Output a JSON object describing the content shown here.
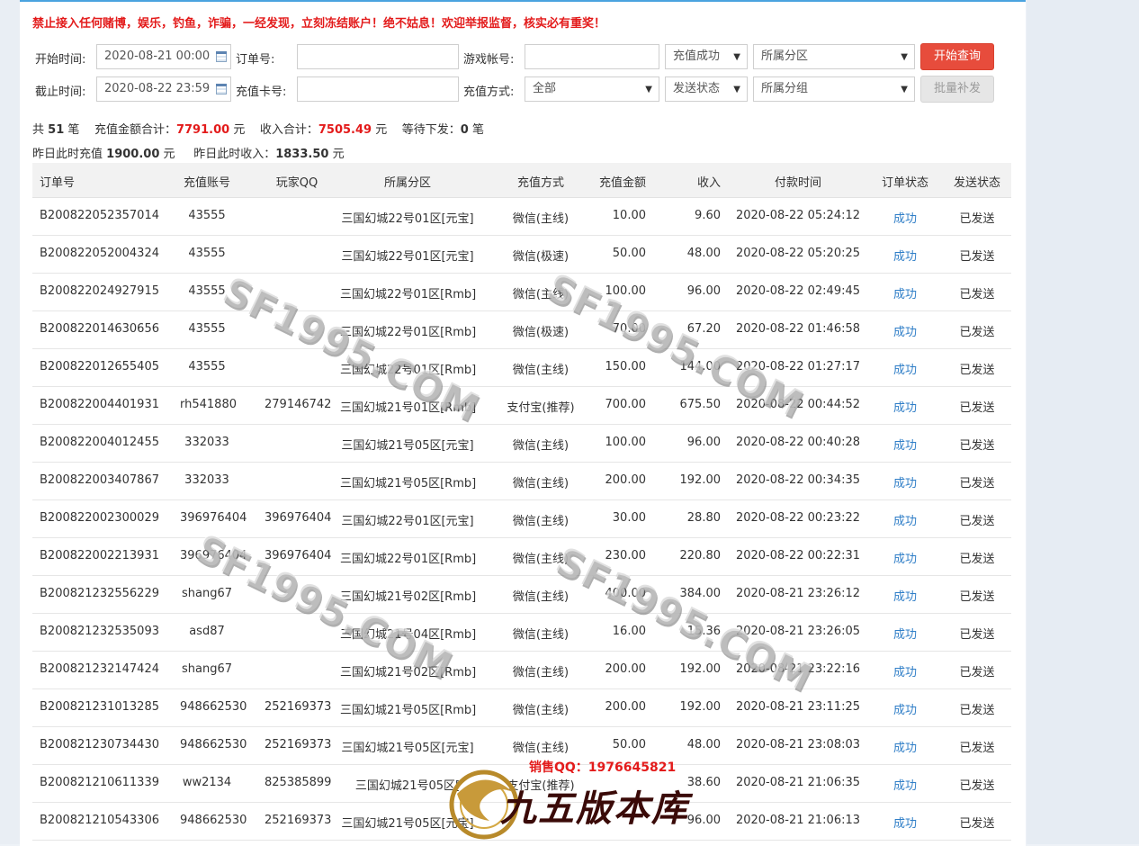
{
  "warning": "禁止接入任何赌博，娱乐，钓鱼，诈骗，一经发现，立刻冻结账户！绝不姑息！欢迎举报监督，核实必有重奖！",
  "filters": {
    "start_time_label": "开始时间:",
    "start_time_value": "2020-08-21 00:00",
    "end_time_label": "截止时间:",
    "end_time_value": "2020-08-22 23:59",
    "order_no_label": "订单号:",
    "order_no_value": "",
    "card_no_label": "充值卡号:",
    "card_no_value": "",
    "game_account_label": "游戏帐号:",
    "game_account_value": "",
    "pay_method_label": "充值方式:",
    "pay_method_value": "全部",
    "recharge_status_value": "充值成功",
    "send_status_value": "发送状态",
    "zone_value": "所属分区",
    "group_value": "所属分组",
    "query_button": "开始查询",
    "batch_button": "批量补发"
  },
  "summary": {
    "total_prefix": "共",
    "total_count": "51",
    "total_unit": "笔",
    "recharge_sum_label": "充值金额合计：",
    "recharge_sum": "7791.00",
    "income_sum_label": "收入合计：",
    "income_sum": "7505.49",
    "currency": "元",
    "pending_label": "等待下发：",
    "pending_count": "0",
    "yesterday_recharge_label": "昨日此时充值",
    "yesterday_recharge": "1900.00",
    "yesterday_income_label": "昨日此时收入：",
    "yesterday_income": "1833.50"
  },
  "table": {
    "headers": [
      "订单号",
      "充值账号",
      "玩家QQ",
      "所属分区",
      "充值方式",
      "充值金额",
      "收入",
      "付款时间",
      "订单状态",
      "发送状态"
    ],
    "rows": [
      [
        "B200822052357014",
        "43555",
        "",
        "三国幻城22号01区[元宝]",
        "微信(主线)",
        "10.00",
        "9.60",
        "2020-08-22 05:24:12",
        "成功",
        "已发送"
      ],
      [
        "B200822052004324",
        "43555",
        "",
        "三国幻城22号01区[元宝]",
        "微信(极速)",
        "50.00",
        "48.00",
        "2020-08-22 05:20:25",
        "成功",
        "已发送"
      ],
      [
        "B200822024927915",
        "43555",
        "",
        "三国幻城22号01区[Rmb]",
        "微信(主线)",
        "100.00",
        "96.00",
        "2020-08-22 02:49:45",
        "成功",
        "已发送"
      ],
      [
        "B200822014630656",
        "43555",
        "",
        "三国幻城22号01区[Rmb]",
        "微信(极速)",
        "70.00",
        "67.20",
        "2020-08-22 01:46:58",
        "成功",
        "已发送"
      ],
      [
        "B200822012655405",
        "43555",
        "",
        "三国幻城22号01区[Rmb]",
        "微信(主线)",
        "150.00",
        "144.00",
        "2020-08-22 01:27:17",
        "成功",
        "已发送"
      ],
      [
        "B200822004401931",
        "rh541880",
        "279146742",
        "三国幻城21号01区[Rmb]",
        "支付宝(推荐)",
        "700.00",
        "675.50",
        "2020-08-22 00:44:52",
        "成功",
        "已发送"
      ],
      [
        "B200822004012455",
        "332033",
        "",
        "三国幻城21号05区[元宝]",
        "微信(主线)",
        "100.00",
        "96.00",
        "2020-08-22 00:40:28",
        "成功",
        "已发送"
      ],
      [
        "B200822003407867",
        "332033",
        "",
        "三国幻城21号05区[Rmb]",
        "微信(主线)",
        "200.00",
        "192.00",
        "2020-08-22 00:34:35",
        "成功",
        "已发送"
      ],
      [
        "B200822002300029",
        "396976404",
        "396976404",
        "三国幻城22号01区[元宝]",
        "微信(主线)",
        "30.00",
        "28.80",
        "2020-08-22 00:23:22",
        "成功",
        "已发送"
      ],
      [
        "B200822002213931",
        "396976404",
        "396976404",
        "三国幻城22号01区[Rmb]",
        "微信(主线)",
        "230.00",
        "220.80",
        "2020-08-22 00:22:31",
        "成功",
        "已发送"
      ],
      [
        "B200821232556229",
        "shang67",
        "",
        "三国幻城21号02区[Rmb]",
        "微信(主线)",
        "400.00",
        "384.00",
        "2020-08-21 23:26:12",
        "成功",
        "已发送"
      ],
      [
        "B200821232535093",
        "asd87",
        "",
        "三国幻城21号04区[Rmb]",
        "微信(主线)",
        "16.00",
        "15.36",
        "2020-08-21 23:26:05",
        "成功",
        "已发送"
      ],
      [
        "B200821232147424",
        "shang67",
        "",
        "三国幻城21号02区[Rmb]",
        "微信(主线)",
        "200.00",
        "192.00",
        "2020-08-21 23:22:16",
        "成功",
        "已发送"
      ],
      [
        "B200821231013285",
        "948662530",
        "252169373",
        "三国幻城21号05区[Rmb]",
        "微信(主线)",
        "200.00",
        "192.00",
        "2020-08-21 23:11:25",
        "成功",
        "已发送"
      ],
      [
        "B200821230734430",
        "948662530",
        "252169373",
        "三国幻城21号05区[元宝]",
        "微信(主线)",
        "50.00",
        "48.00",
        "2020-08-21 23:08:03",
        "成功",
        "已发送"
      ],
      [
        "B200821210611339",
        "ww2134",
        "825385899",
        "三国幻城21号05区[",
        "支付宝(推荐)",
        "",
        "38.60",
        "2020-08-21 21:06:35",
        "成功",
        "已发送"
      ],
      [
        "B200821210543306",
        "948662530",
        "252169373",
        "三国幻城21号05区[元宝]",
        "",
        "",
        "96.00",
        "2020-08-21 21:06:13",
        "成功",
        "已发送"
      ]
    ]
  },
  "watermarks": [
    "SF1995.COM",
    "SF1995.COM",
    "SF1995.COM",
    "SF1995.COM"
  ],
  "logo": {
    "qq_text": "销售QQ：1976645821",
    "brand_text": "九五版本库"
  },
  "colors": {
    "accent_red": "#e31b1b",
    "button_red": "#e74c3c",
    "link_blue": "#2f7ec7",
    "top_border": "#4aa3df"
  }
}
